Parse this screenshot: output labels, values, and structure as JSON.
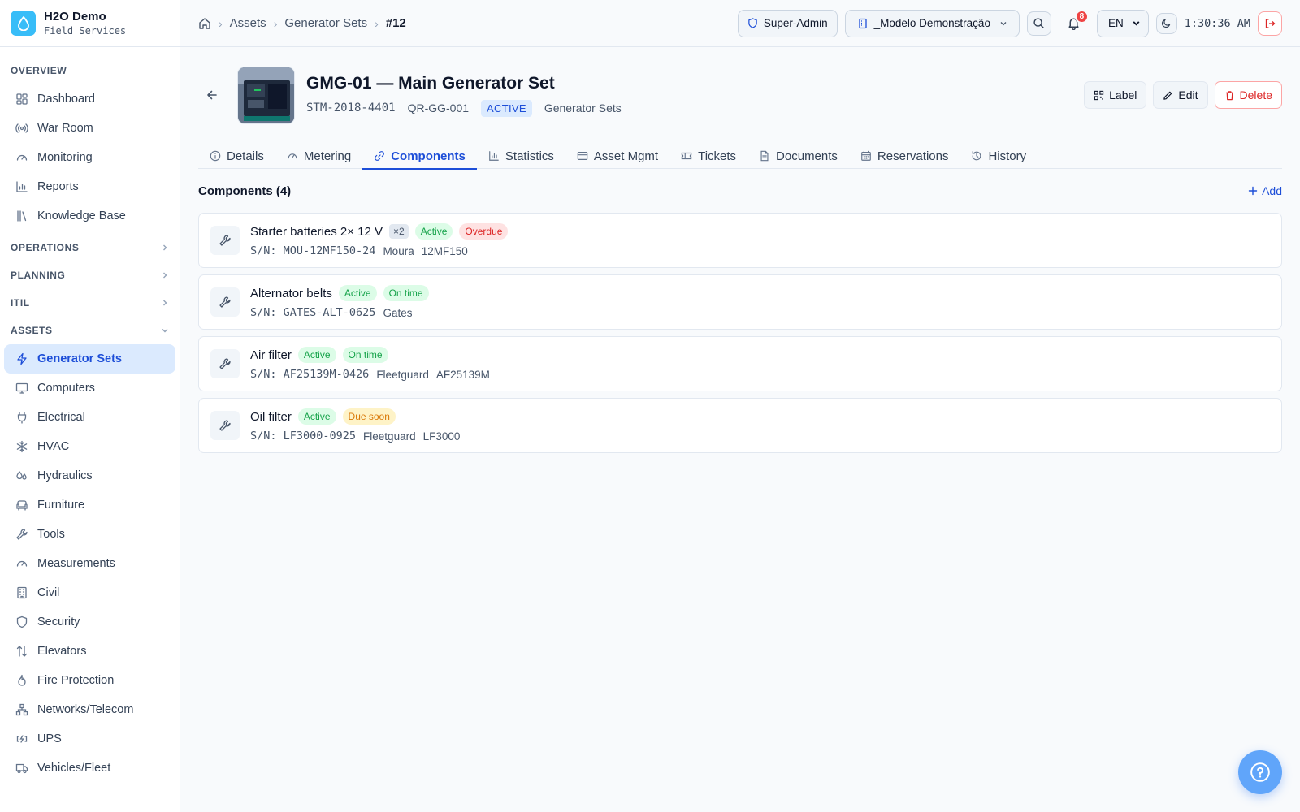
{
  "brand": {
    "name": "H2O Demo",
    "subtitle": "Field Services"
  },
  "sidebar": {
    "overview_title": "OVERVIEW",
    "overview_items": [
      {
        "label": "Dashboard",
        "icon": "dashboard-icon"
      },
      {
        "label": "War Room",
        "icon": "broadcast-icon"
      },
      {
        "label": "Monitoring",
        "icon": "gauge-icon"
      },
      {
        "label": "Reports",
        "icon": "bar-chart-icon"
      },
      {
        "label": "Knowledge Base",
        "icon": "library-icon"
      }
    ],
    "operations_title": "OPERATIONS",
    "planning_title": "PLANNING",
    "itil_title": "ITIL",
    "assets_title": "ASSETS",
    "asset_items": [
      {
        "label": "Generator Sets",
        "icon": "zap-icon",
        "active": true
      },
      {
        "label": "Computers",
        "icon": "monitor-icon"
      },
      {
        "label": "Electrical",
        "icon": "plug-icon"
      },
      {
        "label": "HVAC",
        "icon": "snowflake-icon"
      },
      {
        "label": "Hydraulics",
        "icon": "droplets-icon"
      },
      {
        "label": "Furniture",
        "icon": "sofa-icon"
      },
      {
        "label": "Tools",
        "icon": "wrench-icon"
      },
      {
        "label": "Measurements",
        "icon": "gauge-icon"
      },
      {
        "label": "Civil",
        "icon": "building-icon"
      },
      {
        "label": "Security",
        "icon": "shield-icon"
      },
      {
        "label": "Elevators",
        "icon": "arrows-up-down-icon"
      },
      {
        "label": "Fire Protection",
        "icon": "flame-icon"
      },
      {
        "label": "Networks/Telecom",
        "icon": "network-icon"
      },
      {
        "label": "UPS",
        "icon": "battery-icon"
      },
      {
        "label": "Vehicles/Fleet",
        "icon": "truck-icon"
      }
    ]
  },
  "breadcrumb": {
    "assets": "Assets",
    "category": "Generator Sets",
    "current": "#12"
  },
  "topbar": {
    "role": "Super-Admin",
    "tenant": "_Modelo Demonstração",
    "notifications": "8",
    "language": "EN",
    "time": "1:30:36 AM"
  },
  "asset": {
    "title": "GMG-01 — Main Generator Set",
    "code": "STM-2018-4401",
    "qr": "QR-GG-001",
    "status": "ACTIVE",
    "category": "Generator Sets"
  },
  "actions": {
    "label": "Label",
    "edit": "Edit",
    "delete": "Delete"
  },
  "tabs": [
    {
      "label": "Details",
      "icon": "info-icon"
    },
    {
      "label": "Metering",
      "icon": "gauge-icon"
    },
    {
      "label": "Components",
      "icon": "link-icon",
      "active": true
    },
    {
      "label": "Statistics",
      "icon": "bar-chart-icon"
    },
    {
      "label": "Asset Mgmt",
      "icon": "credit-card-icon"
    },
    {
      "label": "Tickets",
      "icon": "ticket-icon"
    },
    {
      "label": "Documents",
      "icon": "file-icon"
    },
    {
      "label": "Reservations",
      "icon": "calendar-icon"
    },
    {
      "label": "History",
      "icon": "history-icon"
    }
  ],
  "components": {
    "title": "Components (4)",
    "add_label": "Add",
    "items": [
      {
        "name": "Starter batteries 2× 12 V",
        "qty": "×2",
        "status": "Active",
        "due": "Overdue",
        "due_color": "red",
        "serial": "S/N: MOU-12MF150-24",
        "brand": "Moura",
        "model": "12MF150"
      },
      {
        "name": "Alternator belts",
        "qty": "",
        "status": "Active",
        "due": "On time",
        "due_color": "green",
        "serial": "S/N: GATES-ALT-0625",
        "brand": "Gates",
        "model": ""
      },
      {
        "name": "Air filter",
        "qty": "",
        "status": "Active",
        "due": "On time",
        "due_color": "green",
        "serial": "S/N: AF25139M-0426",
        "brand": "Fleetguard",
        "model": "AF25139M"
      },
      {
        "name": "Oil filter",
        "qty": "",
        "status": "Active",
        "due": "Due soon",
        "due_color": "amber",
        "serial": "S/N: LF3000-0925",
        "brand": "Fleetguard",
        "model": "LF3000"
      }
    ]
  },
  "colors": {
    "accent": "#1d4ed8",
    "accent_light": "#dbeafe",
    "danger": "#dc2626",
    "success": "#16a34a",
    "warning": "#d97706"
  }
}
